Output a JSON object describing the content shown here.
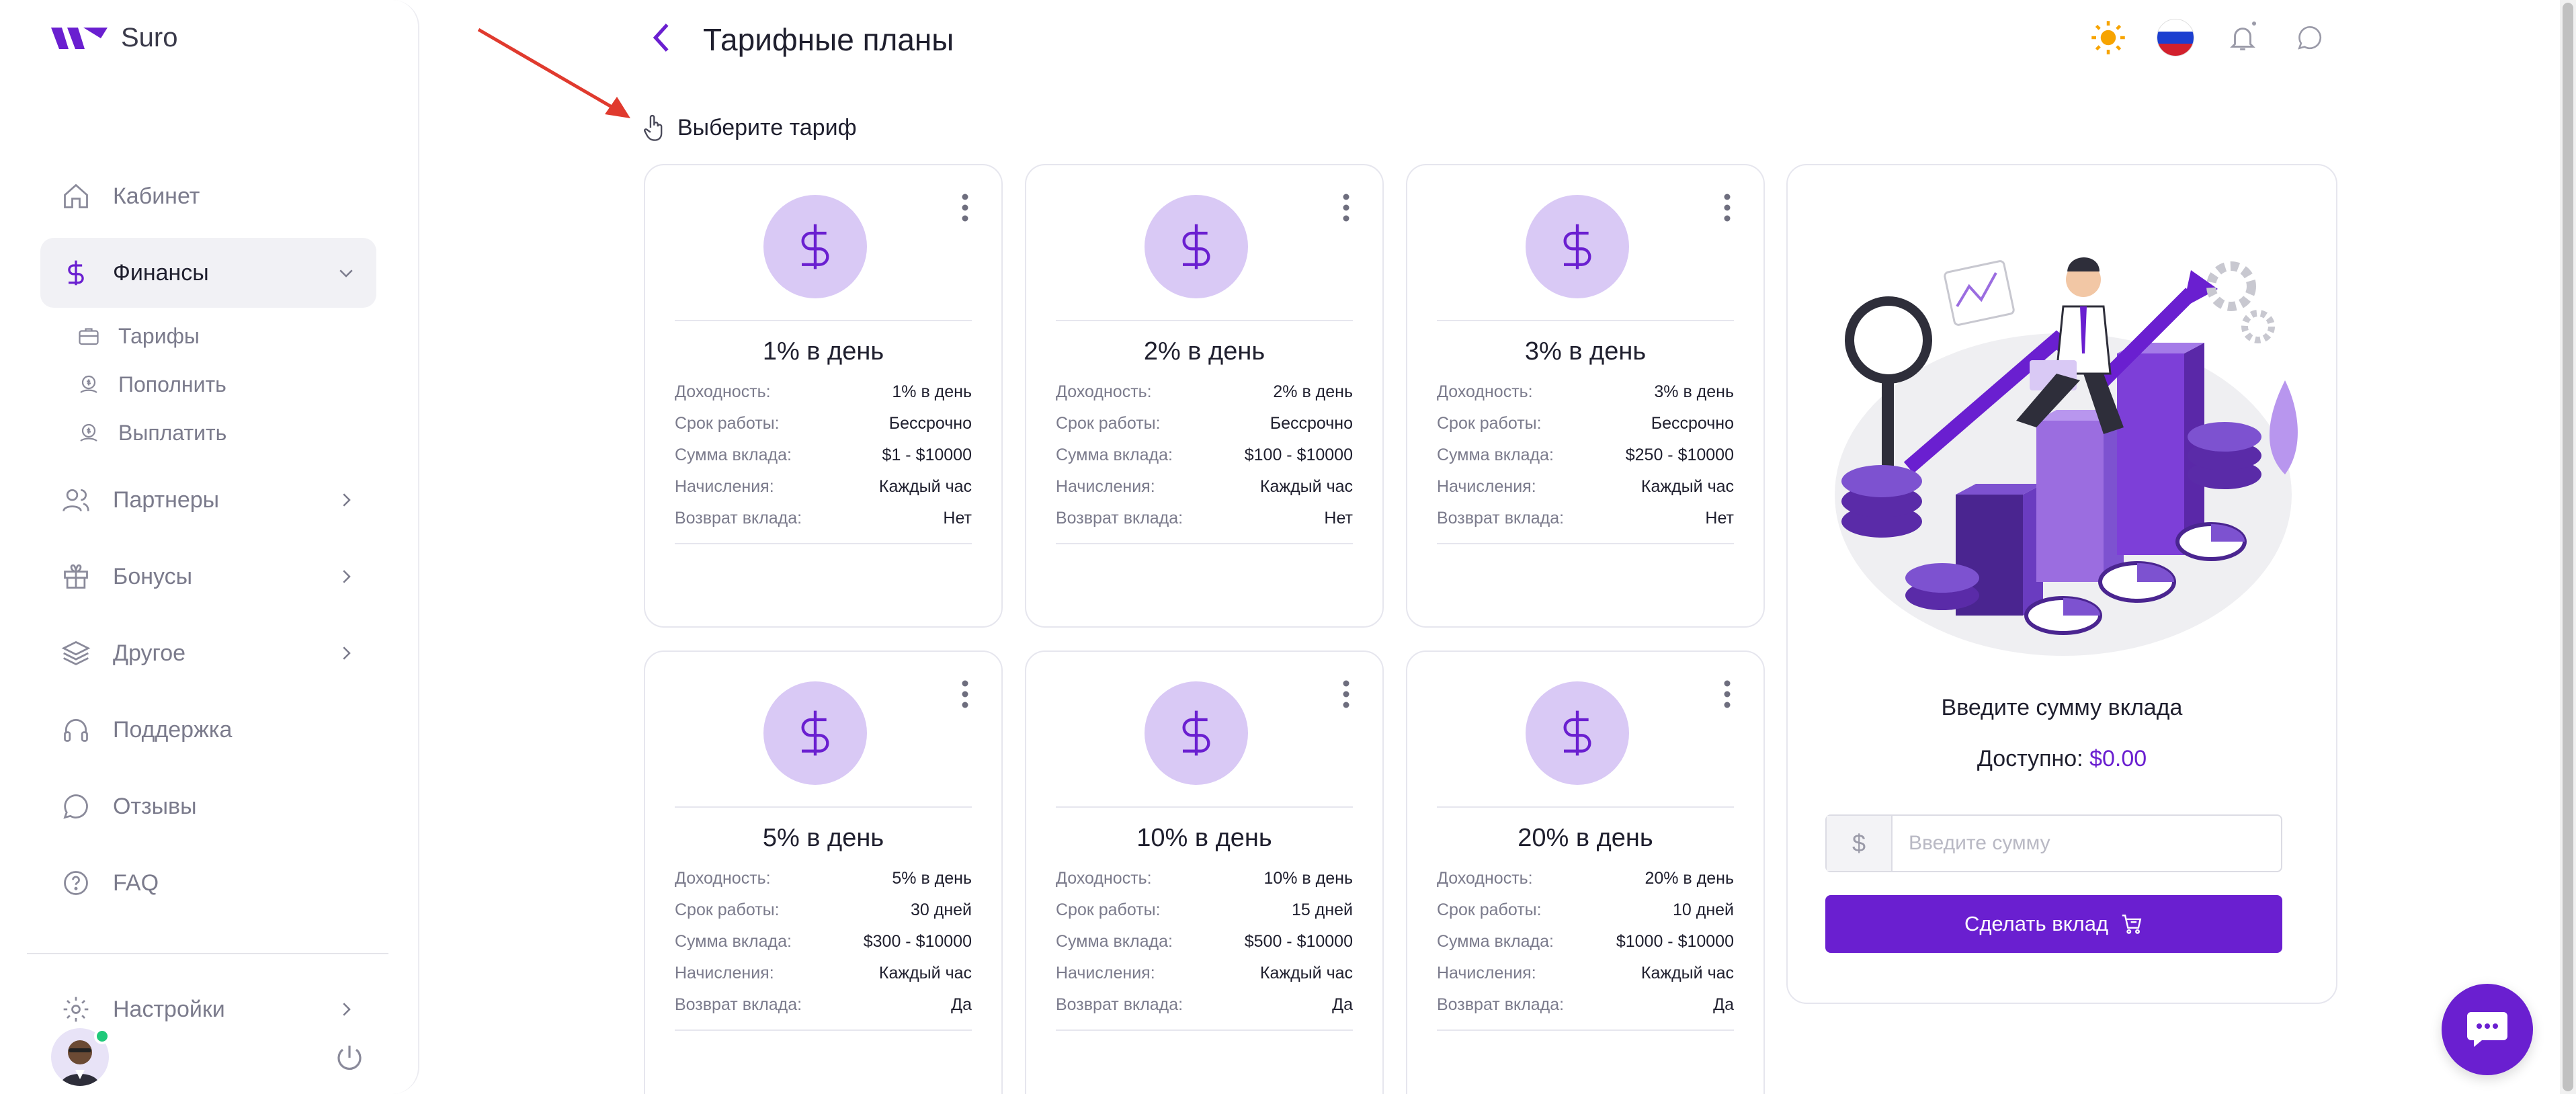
{
  "app": {
    "brand": "Suro"
  },
  "header": {
    "title": "Тарифные планы"
  },
  "sidebar": {
    "items": [
      {
        "label": "Кабинет",
        "icon": "home-icon"
      },
      {
        "label": "Финансы",
        "icon": "dollar-icon",
        "active": true
      },
      {
        "label": "Партнеры",
        "icon": "users-icon"
      },
      {
        "label": "Бонусы",
        "icon": "gift-icon"
      },
      {
        "label": "Другое",
        "icon": "layers-icon"
      },
      {
        "label": "Поддержка",
        "icon": "headset-icon"
      },
      {
        "label": "Отзывы",
        "icon": "chat-icon"
      },
      {
        "label": "FAQ",
        "icon": "question-icon"
      }
    ],
    "finance_sub": [
      {
        "label": "Тарифы",
        "icon": "briefcase-icon"
      },
      {
        "label": "Пополнить",
        "icon": "deposit-icon"
      },
      {
        "label": "Выплатить",
        "icon": "withdraw-icon"
      }
    ],
    "settings": "Настройки"
  },
  "choose_label": "Выберите тариф",
  "row_labels": {
    "yield": "Доходность:",
    "term": "Срок работы:",
    "amount": "Сумма вклада:",
    "accrual": "Начисления:",
    "refund": "Возврат вклада:"
  },
  "plans": [
    {
      "title": "1% в день",
      "yield": "1% в день",
      "term": "Бессрочно",
      "amount": "$1 - $10000",
      "accrual": "Каждый час",
      "refund": "Нет"
    },
    {
      "title": "2% в день",
      "yield": "2% в день",
      "term": "Бессрочно",
      "amount": "$100 - $10000",
      "accrual": "Каждый час",
      "refund": "Нет"
    },
    {
      "title": "3% в день",
      "yield": "3% в день",
      "term": "Бессрочно",
      "amount": "$250 - $10000",
      "accrual": "Каждый час",
      "refund": "Нет"
    },
    {
      "title": "5% в день",
      "yield": "5% в день",
      "term": "30 дней",
      "amount": "$300 - $10000",
      "accrual": "Каждый час",
      "refund": "Да"
    },
    {
      "title": "10% в день",
      "yield": "10% в день",
      "term": "15 дней",
      "amount": "$500 - $10000",
      "accrual": "Каждый час",
      "refund": "Да"
    },
    {
      "title": "20% в день",
      "yield": "20% в день",
      "term": "10 дней",
      "amount": "$1000 - $10000",
      "accrual": "Каждый час",
      "refund": "Да"
    }
  ],
  "deposit": {
    "title": "Введите сумму вклада",
    "available_label": "Доступно:",
    "available_amount": "$0.00",
    "currency_prefix": "$",
    "placeholder": "Введите сумму",
    "button": "Сделать вклад"
  },
  "colors": {
    "accent": "#6a1fd0",
    "coin": "#d9c9f5"
  }
}
